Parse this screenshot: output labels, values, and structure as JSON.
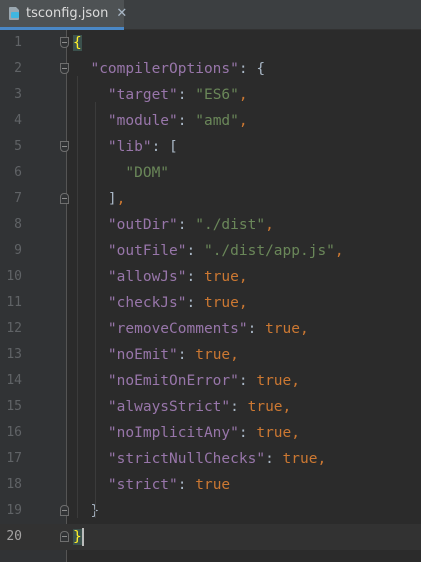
{
  "tab": {
    "label": "tsconfig.json",
    "close_glyph": "✕",
    "icon": "json-file-icon"
  },
  "editor": {
    "current_line": 20,
    "lines": [
      {
        "num": "1",
        "tokens": [
          {
            "t": "{",
            "c": "hl-brace"
          }
        ]
      },
      {
        "num": "2",
        "tokens": [
          {
            "t": "  "
          },
          {
            "t": "\"compilerOptions\"",
            "c": "key"
          },
          {
            "t": ": "
          },
          {
            "t": "{",
            "c": "brace"
          }
        ]
      },
      {
        "num": "3",
        "tokens": [
          {
            "t": "    "
          },
          {
            "t": "\"target\"",
            "c": "key"
          },
          {
            "t": ": "
          },
          {
            "t": "\"ES6\"",
            "c": "str"
          },
          {
            "t": ",",
            "c": "punct"
          }
        ]
      },
      {
        "num": "4",
        "tokens": [
          {
            "t": "    "
          },
          {
            "t": "\"module\"",
            "c": "key"
          },
          {
            "t": ": "
          },
          {
            "t": "\"amd\"",
            "c": "str"
          },
          {
            "t": ",",
            "c": "punct"
          }
        ]
      },
      {
        "num": "5",
        "tokens": [
          {
            "t": "    "
          },
          {
            "t": "\"lib\"",
            "c": "key"
          },
          {
            "t": ": "
          },
          {
            "t": "[",
            "c": "brace"
          }
        ]
      },
      {
        "num": "6",
        "tokens": [
          {
            "t": "      "
          },
          {
            "t": "\"DOM\"",
            "c": "str"
          }
        ]
      },
      {
        "num": "7",
        "tokens": [
          {
            "t": "    "
          },
          {
            "t": "]",
            "c": "brace"
          },
          {
            "t": ",",
            "c": "punct"
          }
        ]
      },
      {
        "num": "8",
        "tokens": [
          {
            "t": "    "
          },
          {
            "t": "\"outDir\"",
            "c": "key"
          },
          {
            "t": ": "
          },
          {
            "t": "\"./dist\"",
            "c": "str"
          },
          {
            "t": ",",
            "c": "punct"
          }
        ]
      },
      {
        "num": "9",
        "tokens": [
          {
            "t": "    "
          },
          {
            "t": "\"outFile\"",
            "c": "key"
          },
          {
            "t": ": "
          },
          {
            "t": "\"./dist/app.js\"",
            "c": "str"
          },
          {
            "t": ",",
            "c": "punct"
          }
        ]
      },
      {
        "num": "10",
        "tokens": [
          {
            "t": "    "
          },
          {
            "t": "\"allowJs\"",
            "c": "key"
          },
          {
            "t": ": "
          },
          {
            "t": "true",
            "c": "kw"
          },
          {
            "t": ",",
            "c": "punct"
          }
        ]
      },
      {
        "num": "11",
        "tokens": [
          {
            "t": "    "
          },
          {
            "t": "\"checkJs\"",
            "c": "key"
          },
          {
            "t": ": "
          },
          {
            "t": "true",
            "c": "kw"
          },
          {
            "t": ",",
            "c": "punct"
          }
        ]
      },
      {
        "num": "12",
        "tokens": [
          {
            "t": "    "
          },
          {
            "t": "\"removeComments\"",
            "c": "key"
          },
          {
            "t": ": "
          },
          {
            "t": "true",
            "c": "kw"
          },
          {
            "t": ",",
            "c": "punct"
          }
        ]
      },
      {
        "num": "13",
        "tokens": [
          {
            "t": "    "
          },
          {
            "t": "\"noEmit\"",
            "c": "key"
          },
          {
            "t": ": "
          },
          {
            "t": "true",
            "c": "kw"
          },
          {
            "t": ",",
            "c": "punct"
          }
        ]
      },
      {
        "num": "14",
        "tokens": [
          {
            "t": "    "
          },
          {
            "t": "\"noEmitOnError\"",
            "c": "key"
          },
          {
            "t": ": "
          },
          {
            "t": "true",
            "c": "kw"
          },
          {
            "t": ",",
            "c": "punct"
          }
        ]
      },
      {
        "num": "15",
        "tokens": [
          {
            "t": "    "
          },
          {
            "t": "\"alwaysStrict\"",
            "c": "key"
          },
          {
            "t": ": "
          },
          {
            "t": "true",
            "c": "kw"
          },
          {
            "t": ",",
            "c": "punct"
          }
        ]
      },
      {
        "num": "16",
        "tokens": [
          {
            "t": "    "
          },
          {
            "t": "\"noImplicitAny\"",
            "c": "key"
          },
          {
            "t": ": "
          },
          {
            "t": "true",
            "c": "kw"
          },
          {
            "t": ",",
            "c": "punct"
          }
        ]
      },
      {
        "num": "17",
        "tokens": [
          {
            "t": "    "
          },
          {
            "t": "\"strictNullChecks\"",
            "c": "key"
          },
          {
            "t": ": "
          },
          {
            "t": "true",
            "c": "kw"
          },
          {
            "t": ",",
            "c": "punct"
          }
        ]
      },
      {
        "num": "18",
        "tokens": [
          {
            "t": "    "
          },
          {
            "t": "\"strict\"",
            "c": "key"
          },
          {
            "t": ": "
          },
          {
            "t": "true",
            "c": "kw"
          }
        ]
      },
      {
        "num": "19",
        "tokens": [
          {
            "t": "  "
          },
          {
            "t": "}",
            "c": "brace"
          }
        ]
      },
      {
        "num": "20",
        "tokens": [
          {
            "t": "}",
            "c": "hl-brace"
          }
        ]
      }
    ]
  },
  "colors": {
    "background": "#2b2b2b",
    "gutter": "#313335",
    "key": "#9876aa",
    "string": "#6a8759",
    "keyword": "#cc7832",
    "matched_brace": "#ffef28"
  }
}
